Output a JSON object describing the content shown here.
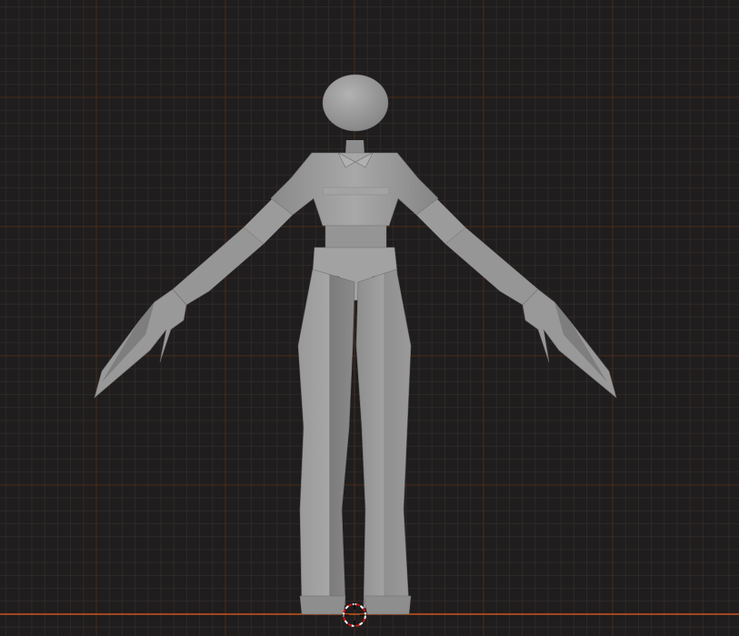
{
  "viewport": {
    "view": "front-orthographic",
    "background_color": "#1f1d1d",
    "grid": {
      "shown": true,
      "minor_line_color": "#2e2a28",
      "major_line_color": "#4a2a1a",
      "x_axis_color": "#c8541e"
    },
    "object": {
      "type": "character-mesh",
      "pose": "T-pose",
      "shading": "solid",
      "base_color": "#9c9c9c",
      "shadow_color": "#6f6f6f",
      "highlight_color": "#b8b8b8"
    },
    "cursor_3d": {
      "shown": true,
      "ring_colors": [
        "#ffffff",
        "#d01010"
      ]
    }
  }
}
